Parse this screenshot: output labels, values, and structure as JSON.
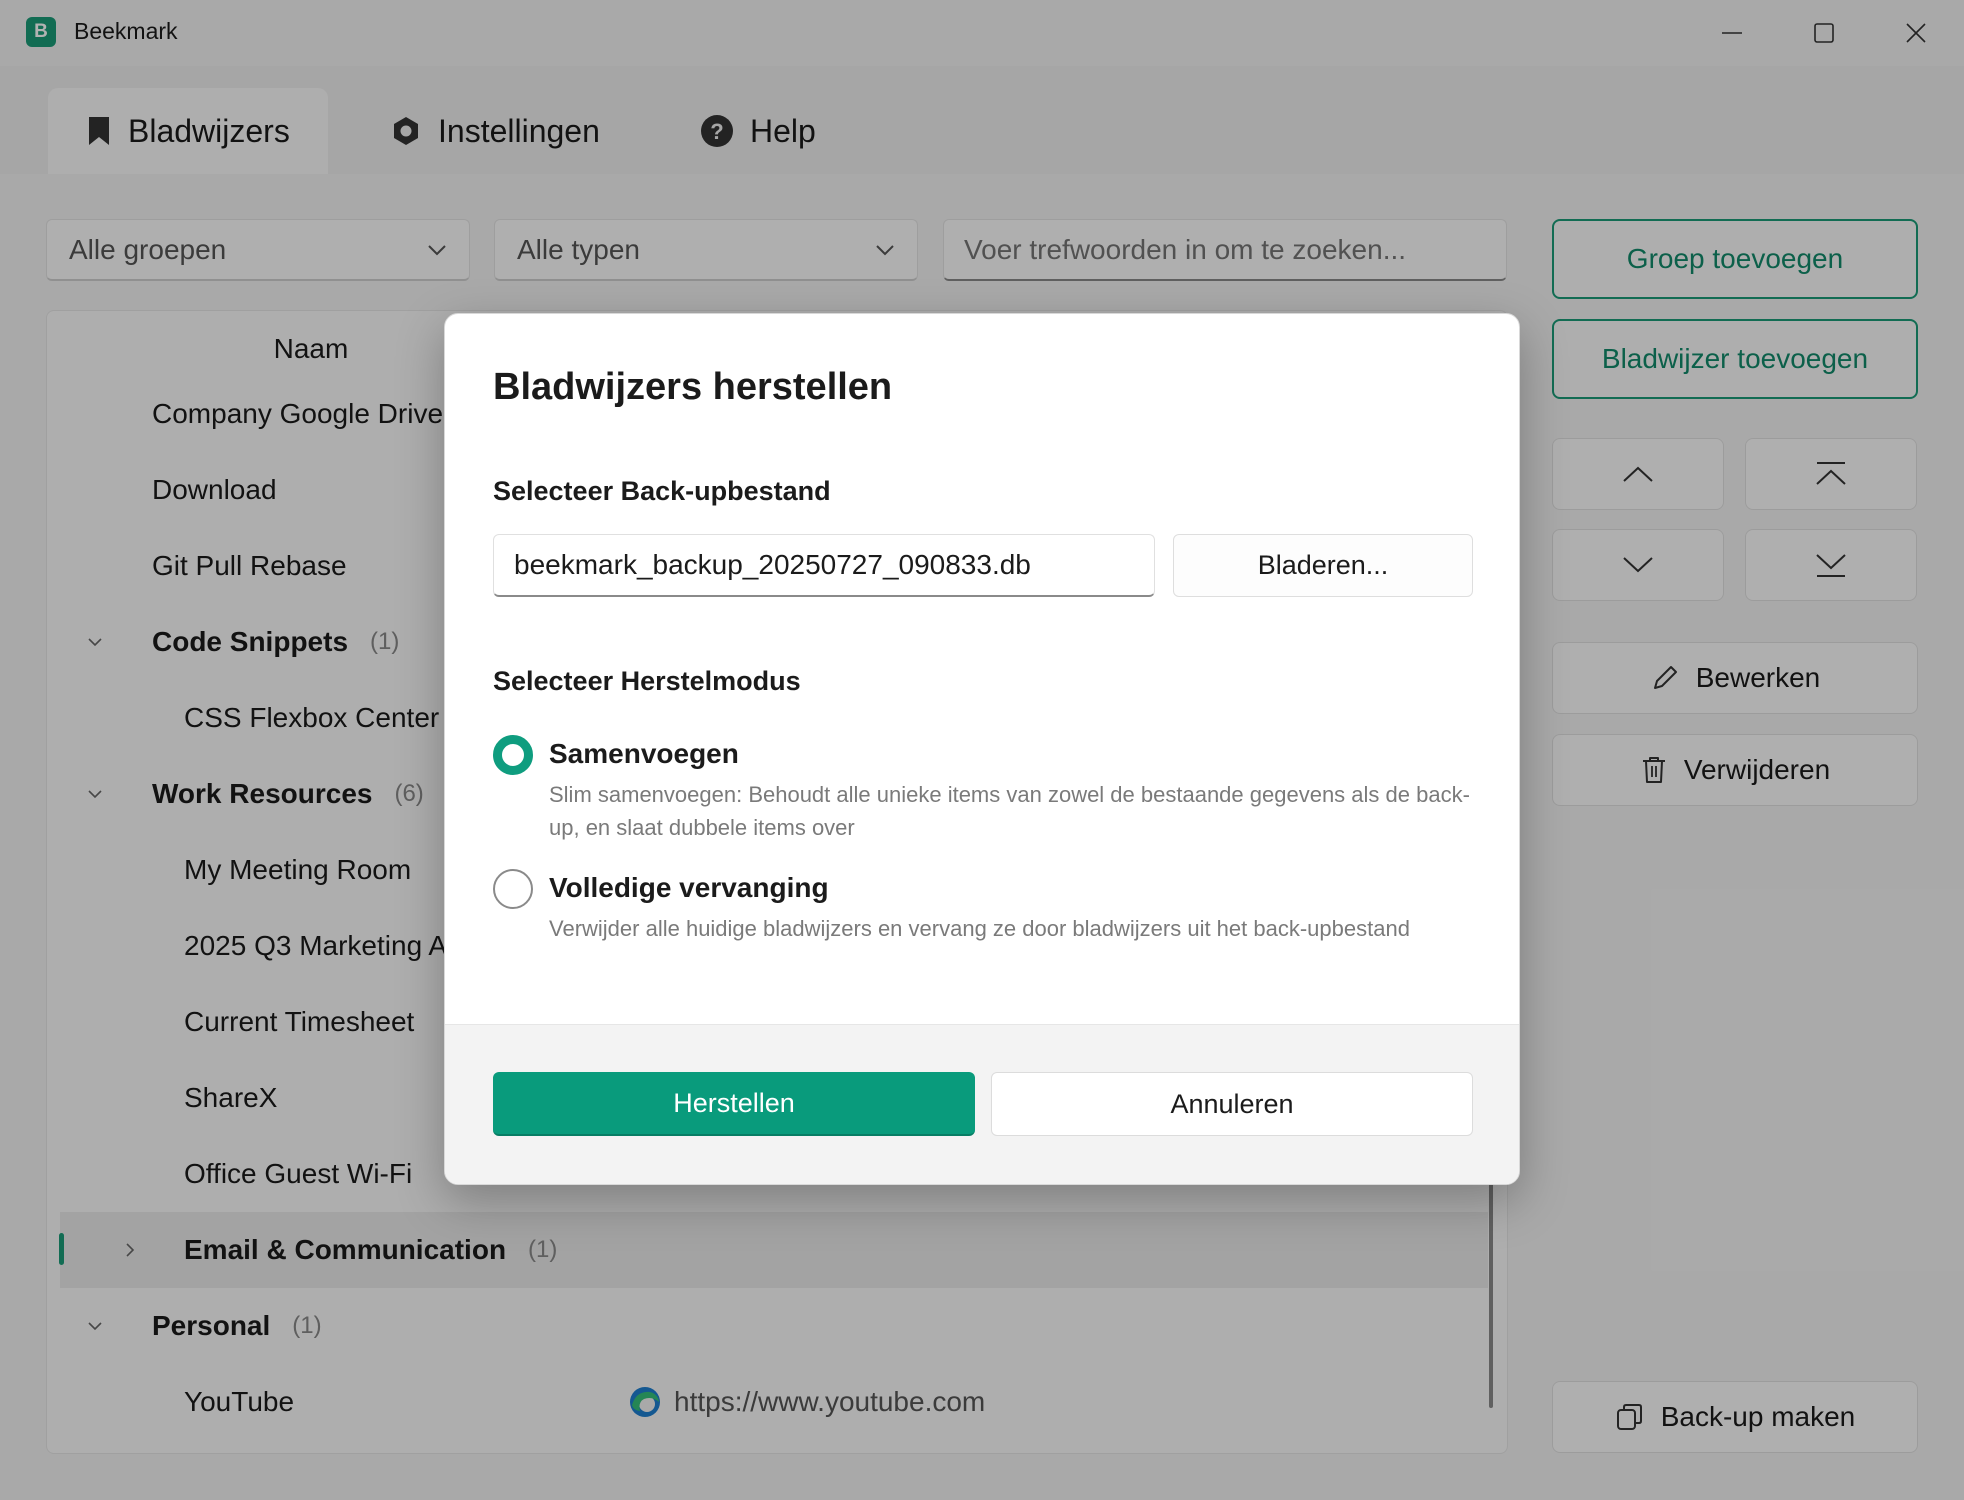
{
  "window": {
    "title": "Beekmark",
    "logo_letter": "B"
  },
  "tabs": [
    {
      "label": "Bladwijzers",
      "icon": "bookmark-icon",
      "active": true
    },
    {
      "label": "Instellingen",
      "icon": "gear-icon",
      "active": false
    },
    {
      "label": "Help",
      "icon": "help-icon",
      "active": false
    }
  ],
  "filters": {
    "group_select": "Alle groepen",
    "type_select": "Alle typen",
    "search_placeholder": "Voer trefwoorden in om te zoeken..."
  },
  "actions": {
    "add_group": "Groep toevoegen",
    "add_bookmark": "Bladwijzer toevoegen",
    "edit": "Bewerken",
    "delete": "Verwijderen",
    "backup": "Back-up maken"
  },
  "list": {
    "column_name": "Naam",
    "rows": [
      {
        "label": "Company Google Drive"
      },
      {
        "label": "Download"
      },
      {
        "label": "Git Pull Rebase"
      },
      {
        "label": "Code Snippets",
        "count": "(1)"
      },
      {
        "label": "CSS Flexbox Center"
      },
      {
        "label": "Work Resources",
        "count": "(6)"
      },
      {
        "label": "My Meeting Room"
      },
      {
        "label": "2025 Q3 Marketing A"
      },
      {
        "label": "Current Timesheet"
      },
      {
        "label": "ShareX"
      },
      {
        "label": "Office Guest Wi-Fi"
      },
      {
        "label": "Email & Communication",
        "count": "(1)"
      },
      {
        "label": "Personal",
        "count": "(1)"
      },
      {
        "label": "YouTube",
        "url": "https://www.youtube.com"
      }
    ]
  },
  "dialog": {
    "title": "Bladwijzers herstellen",
    "file_section": "Selecteer Back-upbestand",
    "file_value": "beekmark_backup_20250727_090833.db",
    "browse": "Bladeren...",
    "mode_section": "Selecteer Herstelmodus",
    "options": [
      {
        "label": "Samenvoegen",
        "selected": true,
        "description": "Slim samenvoegen: Behoudt alle unieke items van zowel de bestaande gegevens als de back-up, en slaat dubbele items over"
      },
      {
        "label": "Volledige vervanging",
        "selected": false,
        "description": "Verwijder alle huidige bladwijzers en vervang ze door bladwijzers uit het back-upbestand"
      }
    ],
    "restore": "Herstellen",
    "cancel": "Annuleren"
  },
  "colors": {
    "accent": "#1a9b78",
    "primary_button": "#099b7c"
  }
}
